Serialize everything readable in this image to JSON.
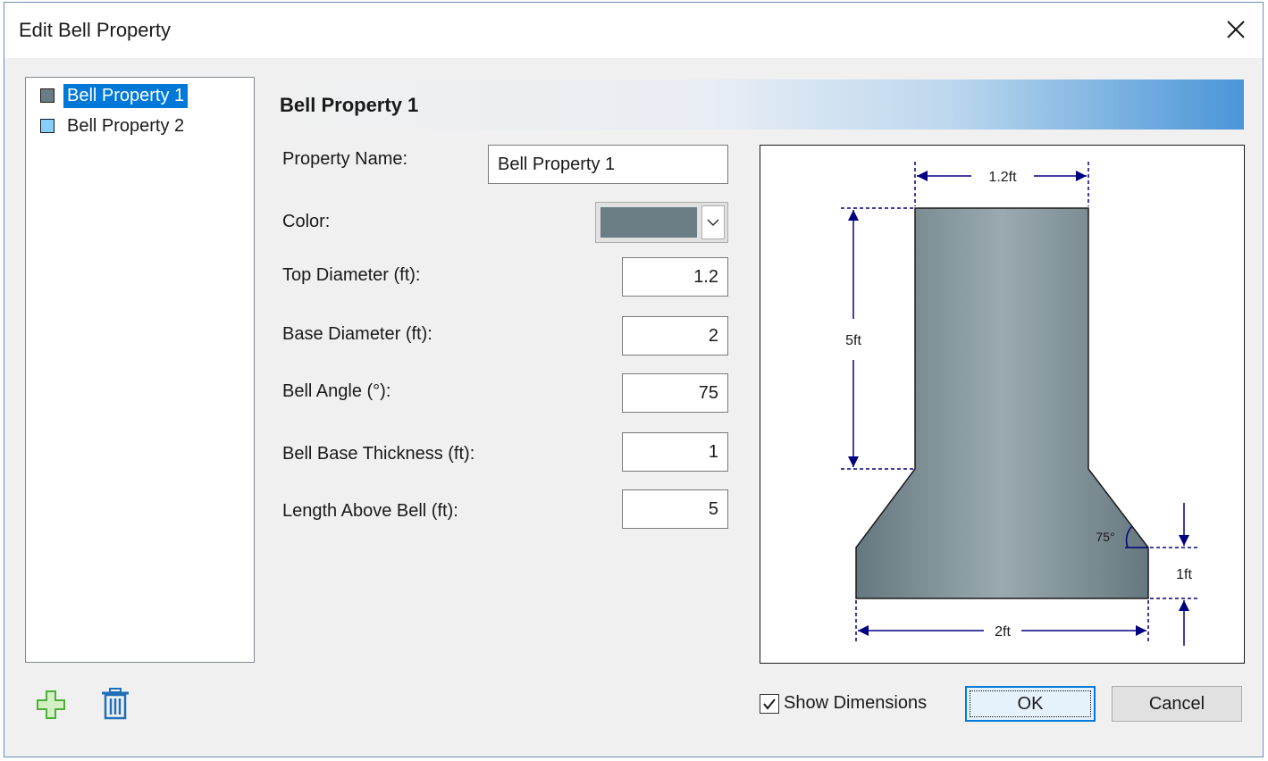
{
  "window": {
    "title": "Edit Bell Property"
  },
  "list": {
    "items": [
      {
        "label": "Bell Property 1",
        "color": "#6a7d85",
        "selected": true
      },
      {
        "label": "Bell Property 2",
        "color": "#87cefa",
        "selected": false
      }
    ]
  },
  "header": {
    "title": "Bell Property 1"
  },
  "form": {
    "property_name": {
      "label": "Property Name:",
      "value": "Bell Property 1"
    },
    "color": {
      "label": "Color:",
      "value": "#6a7d85"
    },
    "top_diameter": {
      "label": "Top Diameter (ft):",
      "value": "1.2"
    },
    "base_diameter": {
      "label": "Base Diameter (ft):",
      "value": "2"
    },
    "bell_angle": {
      "label": "Bell Angle (°):",
      "value": "75"
    },
    "bell_base_thickness": {
      "label": "Bell Base Thickness (ft):",
      "value": "1"
    },
    "length_above_bell": {
      "label": "Length Above Bell (ft):",
      "value": "5"
    }
  },
  "diagram": {
    "top_dim": "1.2ft",
    "length_dim": "5ft",
    "angle_dim": "75°",
    "thickness_dim": "1ft",
    "base_dim": "2ft",
    "dim_color": "#000080"
  },
  "footer": {
    "show_dimensions_label": "Show Dimensions",
    "show_dimensions_checked": true,
    "ok_label": "OK",
    "cancel_label": "Cancel"
  },
  "icons": {
    "add": "plus-icon",
    "delete": "trash-icon",
    "close": "close-icon",
    "dropdown": "chevron-down-icon"
  }
}
